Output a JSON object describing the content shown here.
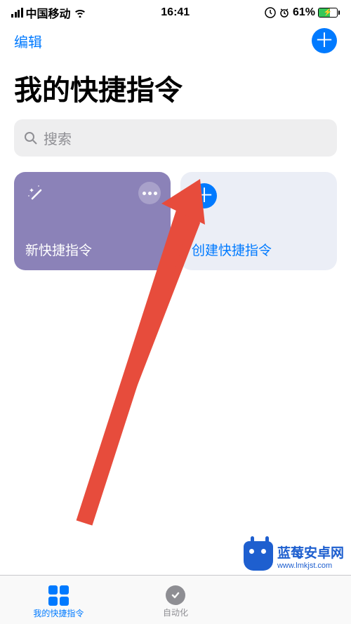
{
  "status": {
    "carrier": "中国移动",
    "time": "16:41",
    "battery": "61%"
  },
  "nav": {
    "edit": "编辑"
  },
  "title": "我的快捷指令",
  "search": {
    "placeholder": "搜索"
  },
  "cards": {
    "new_shortcut": "新快捷指令",
    "create_shortcut": "创建快捷指令"
  },
  "tabs": {
    "shortcuts": "我的快捷指令",
    "automation": "自动化"
  },
  "watermark": {
    "title": "蓝莓安卓网",
    "url": "www.lmkjst.com"
  }
}
